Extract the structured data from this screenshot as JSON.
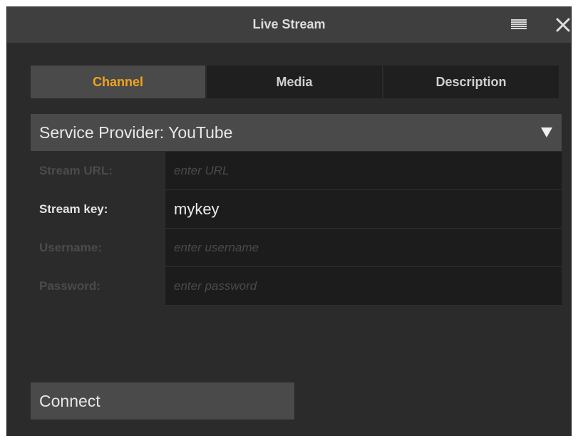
{
  "window": {
    "title": "Live Stream"
  },
  "titlebar_icons": {
    "menu": "hamburger-menu-icon",
    "close": "close-icon"
  },
  "tabs": [
    {
      "label": "Channel",
      "active": true
    },
    {
      "label": "Media",
      "active": false
    },
    {
      "label": "Description",
      "active": false
    }
  ],
  "provider": {
    "label": "Service Provider: YouTube",
    "icon": "dropdown-arrow-icon"
  },
  "fields": [
    {
      "label": "Stream URL:",
      "value": "",
      "placeholder": "enter URL"
    },
    {
      "label": "Stream key:",
      "value": "mykey",
      "placeholder": ""
    },
    {
      "label": "Username:",
      "value": "",
      "placeholder": "enter username"
    },
    {
      "label": "Password:",
      "value": "",
      "placeholder": "enter password"
    }
  ],
  "connect": {
    "label": "Connect"
  },
  "colors": {
    "accent": "#f0a41c",
    "background": "#2b2b2b",
    "titlebar": "#3f3f3f"
  }
}
